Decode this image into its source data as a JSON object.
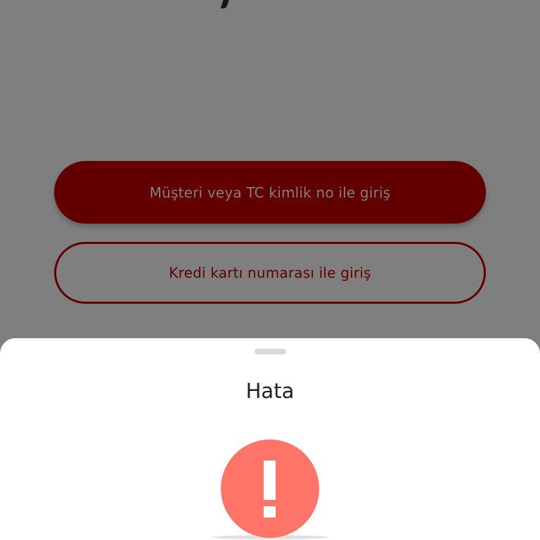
{
  "login": {
    "customer_login_label": "Müşteri veya TC kimlik no ile giriş",
    "card_login_label": "Kredi kartı numarası ile giriş"
  },
  "error_sheet": {
    "title": "Hata",
    "icon": "exclamation-circle-icon",
    "icon_color": "#ff7468"
  },
  "colors": {
    "brand_red": "#c40000",
    "overlay": "rgba(0,0,0,0.5)"
  }
}
